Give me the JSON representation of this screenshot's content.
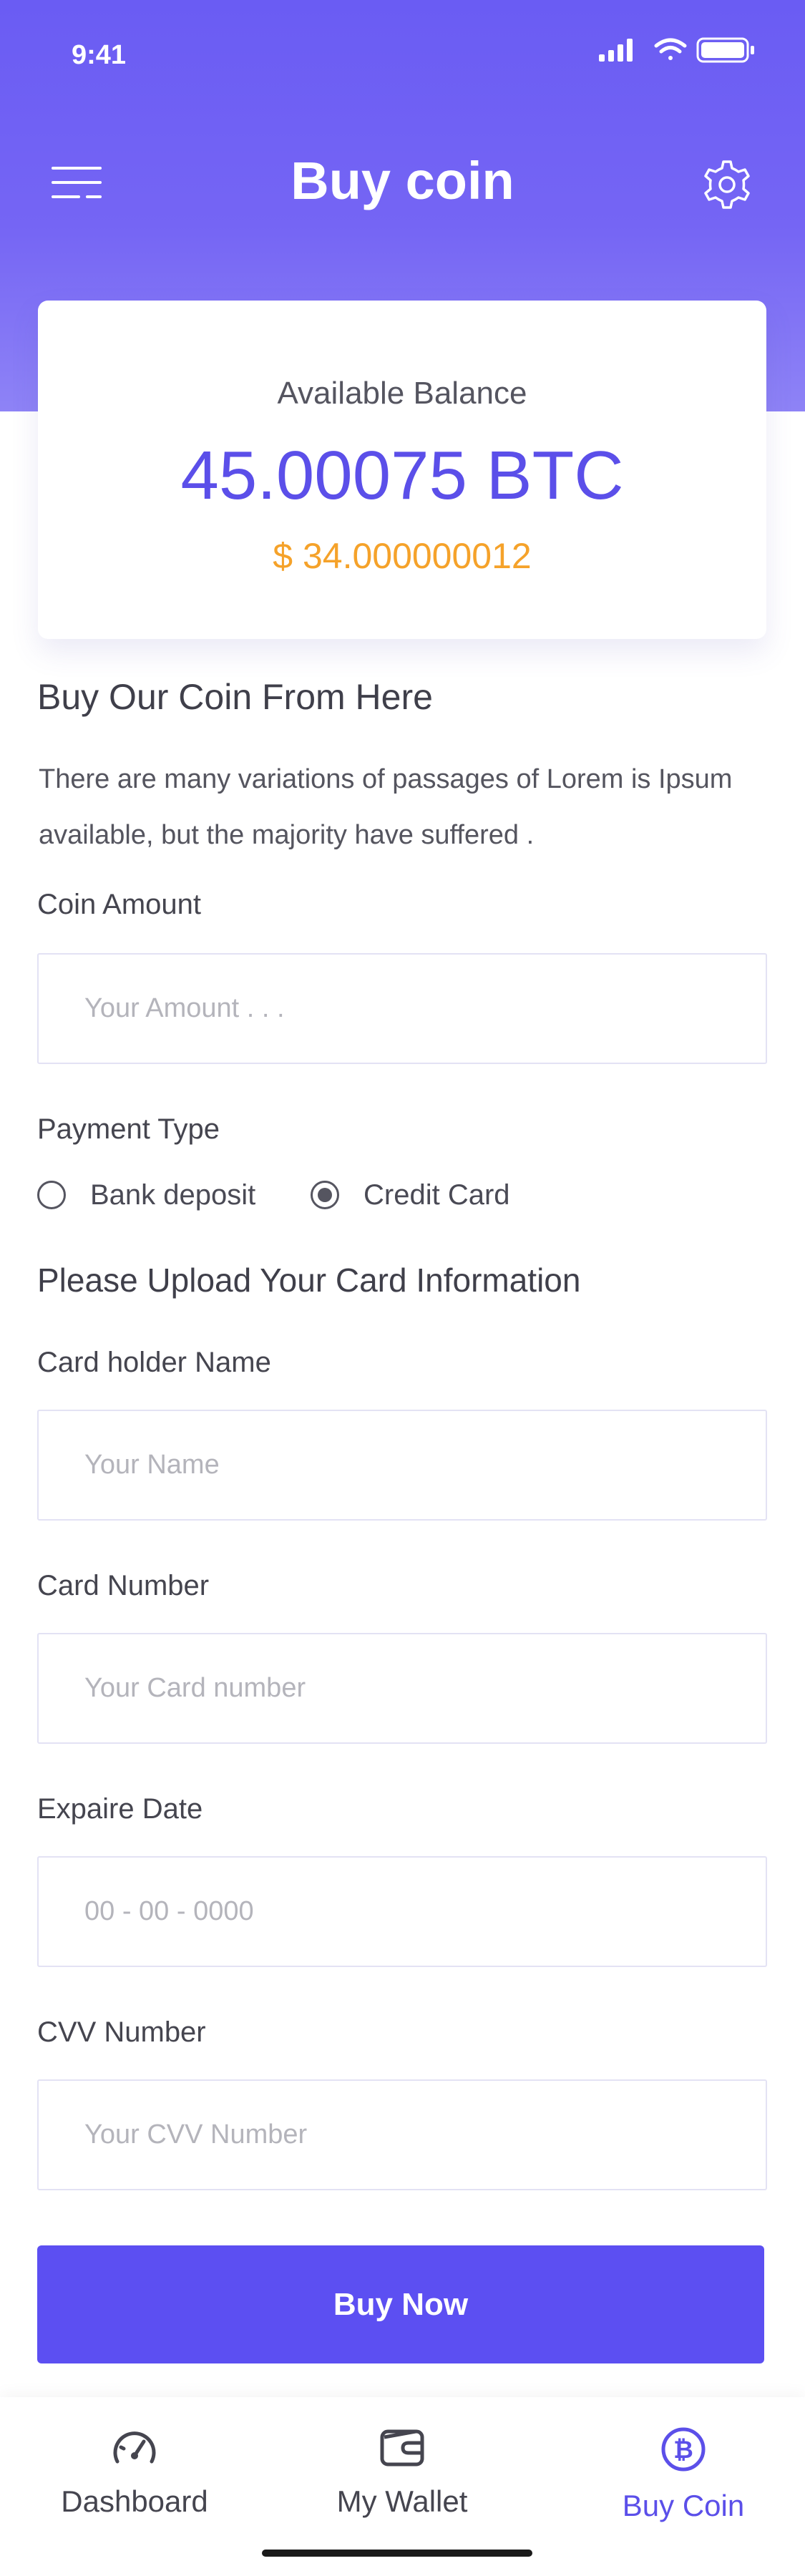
{
  "status_bar": {
    "time": "9:41"
  },
  "header": {
    "title": "Buy coin",
    "menu_icon": "menu-icon",
    "settings_icon": "gear-icon"
  },
  "balance": {
    "label": "Available Balance",
    "btc": "45.00075 BTC",
    "usd": "$ 34.000000012"
  },
  "intro": {
    "title": "Buy Our Coin From Here",
    "description": "There are many variations of passages of Lorem is Ipsum available, but the majority have suffered ."
  },
  "coin_amount": {
    "label": "Coin Amount",
    "placeholder": "Your Amount . . ."
  },
  "payment": {
    "label": "Payment Type",
    "options": [
      {
        "label": "Bank deposit",
        "selected": false
      },
      {
        "label": "Credit Card",
        "selected": true
      }
    ]
  },
  "card_section": {
    "title": "Please Upload Your Card Information"
  },
  "card_holder": {
    "label": "Card holder Name",
    "placeholder": "Your Name"
  },
  "card_number": {
    "label": "Card Number",
    "placeholder": "Your Card number"
  },
  "expire_date": {
    "label": "Expaire Date",
    "placeholder": "00 - 00 - 0000"
  },
  "cvv": {
    "label": "CVV Number",
    "placeholder": "Your CVV Number"
  },
  "buy_button": {
    "label": "Buy Now"
  },
  "bottom_nav": {
    "items": [
      {
        "label": "Dashboard",
        "icon": "speedometer-icon",
        "active": false
      },
      {
        "label": "My Wallet",
        "icon": "wallet-icon",
        "active": false
      },
      {
        "label": "Buy Coin",
        "icon": "bitcoin-icon",
        "active": true
      }
    ]
  },
  "colors": {
    "primary": "#5c4ff2",
    "header_gradient_top": "#6a5cf3",
    "usd_accent": "#f5a22a",
    "text": "#4a4a57"
  }
}
